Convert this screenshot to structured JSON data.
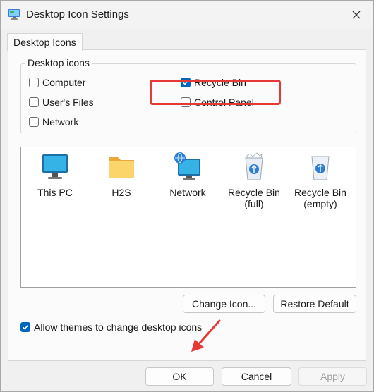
{
  "window": {
    "title": "Desktop Icon Settings",
    "title_icon": "desktop-settings-icon",
    "close_icon": "close-icon"
  },
  "tabs": [
    {
      "label": "Desktop Icons",
      "selected": true
    }
  ],
  "desktop_icons_group": {
    "legend": "Desktop icons",
    "checkboxes": {
      "computer": {
        "label": "Computer",
        "checked": false
      },
      "recycle_bin": {
        "label": "Recycle Bin",
        "checked": true
      },
      "users_files": {
        "label": "User's Files",
        "checked": false
      },
      "control_panel": {
        "label": "Control Panel",
        "checked": false
      },
      "network": {
        "label": "Network",
        "checked": false
      }
    }
  },
  "icon_list": [
    {
      "label": "This PC",
      "icon": "monitor-icon"
    },
    {
      "label": "H2S",
      "icon": "folder-icon"
    },
    {
      "label": "Network",
      "icon": "network-globe-icon"
    },
    {
      "label": "Recycle Bin\n(full)",
      "icon": "recycle-bin-full-icon"
    },
    {
      "label": "Recycle Bin\n(empty)",
      "icon": "recycle-bin-empty-icon"
    }
  ],
  "buttons": {
    "change_icon": "Change Icon...",
    "restore_default": "Restore Default",
    "ok": "OK",
    "cancel": "Cancel",
    "apply": "Apply"
  },
  "allow_themes": {
    "label": "Allow themes to change desktop icons",
    "checked": true
  },
  "colors": {
    "accent": "#0067c0",
    "highlight_box": "#e53935",
    "arrow": "#e53935"
  }
}
